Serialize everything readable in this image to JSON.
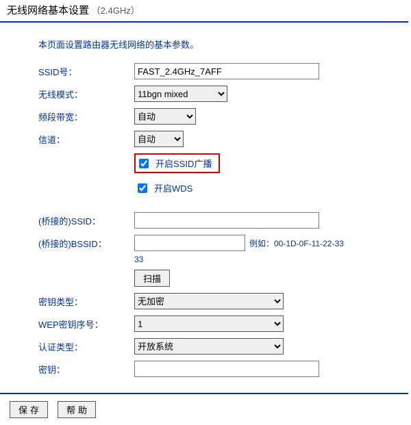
{
  "title": {
    "main": "无线网络基本设置",
    "sub": "（2.4GHz）"
  },
  "description": "本页面设置路由器无线网络的基本参数。",
  "labels": {
    "ssid": "SSID号：",
    "mode": "无线模式：",
    "bandwidth": "频段带宽：",
    "channel": "信道：",
    "ssid_broadcast": "开启SSID广播",
    "wds": "开启WDS",
    "bridge_ssid": "(桥接的)SSID：",
    "bridge_bssid": "(桥接的)BSSID：",
    "bssid_example": "例如：00-1D-0F-11-22-33",
    "scan": "扫描",
    "key_type": "密钥类型：",
    "wep_index": "WEP密钥序号：",
    "auth_type": "认证类型：",
    "key": "密钥："
  },
  "values": {
    "ssid": "FAST_2.4GHz_7AFF",
    "mode": "11bgn mixed",
    "bandwidth": "自动",
    "channel": "自动",
    "ssid_broadcast_checked": true,
    "wds_checked": true,
    "bridge_ssid": "",
    "bridge_bssid": "",
    "key_type": "无加密",
    "wep_index": "1",
    "auth_type": "开放系统",
    "key": ""
  },
  "footer": {
    "save": "保存",
    "help": "帮助"
  }
}
